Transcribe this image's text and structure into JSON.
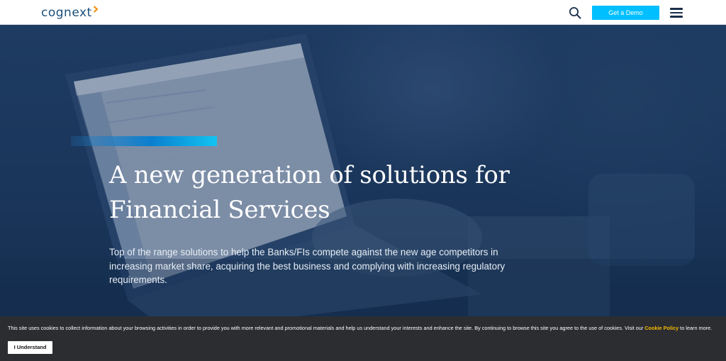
{
  "header": {
    "logo_text": "cognext",
    "demo_button_label": "Get a Demo",
    "icons": {
      "search": "search-icon",
      "menu": "hamburger-menu-icon",
      "logo_mark": "chevron-right-icon"
    },
    "colors": {
      "logo": "#1b4f7a",
      "logo_accent": "#f28c00",
      "demo_button_bg": "#00bfff"
    }
  },
  "hero": {
    "headline": "A new generation of solutions for Financial Services",
    "subtext": "Top of the range solutions to help the Banks/FIs compete against the new age competitors in increasing market share, acquiring the best business and complying with increasing regulatory requirements.",
    "colors": {
      "overlay": "#1f3c61",
      "accent_bar": "#12c4f2"
    }
  },
  "cookie_banner": {
    "message": "This site uses cookies to collect information about your browsing activities in order to provide you with more relevant and promotional materials and help us understand your interests and enhance the site. By continuing to browse this site you agree to the use of cookies. Visit our ",
    "policy_link": "Cookie Policy",
    "message_end": " to learn more.",
    "accept_button_label": "I Understand",
    "colors": {
      "background": "#2b2d31",
      "link": "#f5b800"
    }
  }
}
